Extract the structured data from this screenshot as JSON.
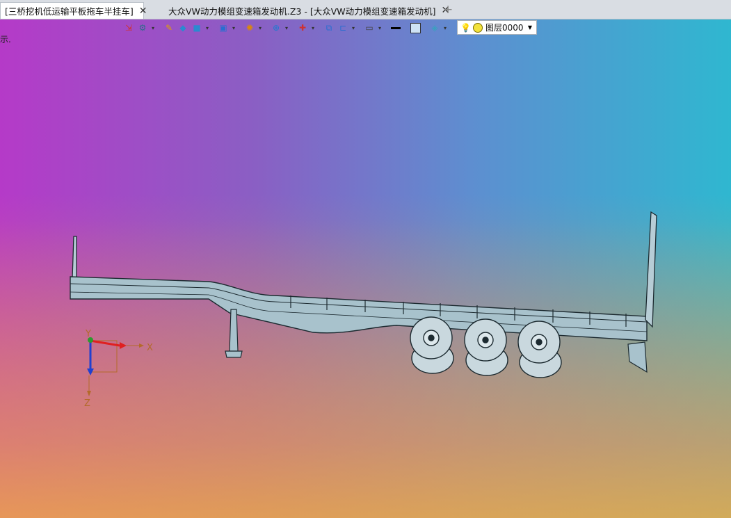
{
  "tabs": [
    {
      "label": "[三桥挖机低运输平板拖车半挂车]",
      "close": "✕",
      "active": true
    },
    {
      "label": "大众VW动力模组变速箱发动机.Z3 - [大众VW动力模组变速箱发动机]",
      "close": "✕",
      "active": false
    }
  ],
  "tab_add": "+",
  "status_fragment": "示.",
  "layer": {
    "name": "图层0000",
    "icon": "lightbulb-icon"
  },
  "axes": {
    "x": "X",
    "y": "Y",
    "z": "Z"
  },
  "colors": {
    "bg_left": "#b53ac8",
    "bg_right": "#2fb7d0",
    "bg_bottom": "#f0aa46",
    "axis_x": "#e02020",
    "axis_y": "#2e9a2e",
    "axis_z": "#2040d0",
    "model_fill": "#a8c2cc"
  }
}
